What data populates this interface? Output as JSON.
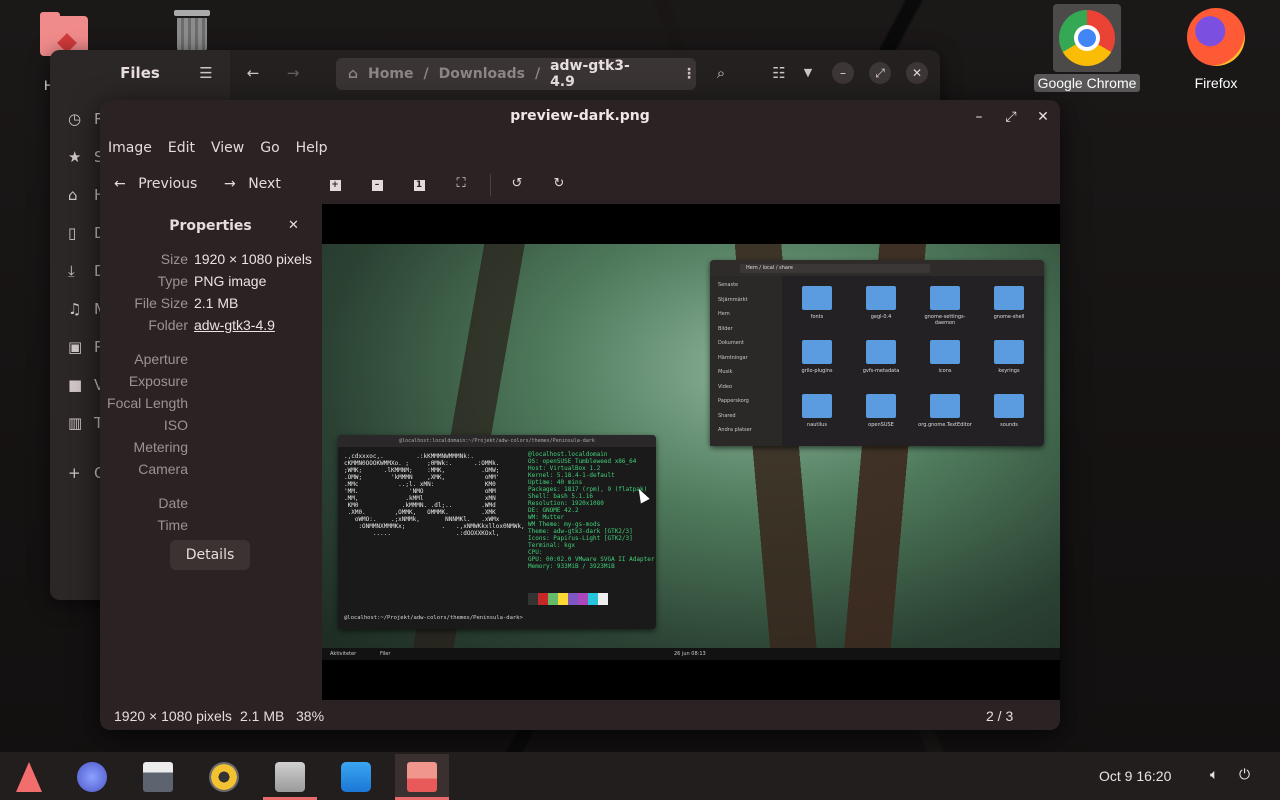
{
  "desktop": {
    "icons": [
      {
        "label": "H",
        "icon": "home-folder-icon"
      },
      {
        "label": "",
        "icon": "trash-icon"
      },
      {
        "label": "Google Chrome",
        "icon": "chrome-icon"
      },
      {
        "label": "Firefox",
        "icon": "firefox-icon"
      }
    ]
  },
  "files_window": {
    "title": "Files",
    "path": [
      "Home",
      "Downloads",
      "adw-gtk3-4.9"
    ],
    "sidebar": [
      "R",
      "S",
      "H",
      "D",
      "D",
      "M",
      "P",
      "V",
      "T",
      "O"
    ]
  },
  "viewer": {
    "title": "preview-dark.png",
    "menu": [
      "Image",
      "Edit",
      "View",
      "Go",
      "Help"
    ],
    "toolbar": {
      "previous": "Previous",
      "next": "Next"
    },
    "properties": {
      "title": "Properties",
      "rows": [
        {
          "key": "Size",
          "value": "1920 × 1080 pixels"
        },
        {
          "key": "Type",
          "value": "PNG image"
        },
        {
          "key": "File Size",
          "value": "2.1 MB"
        },
        {
          "key": "Folder",
          "value": "adw-gtk3-4.9"
        },
        {
          "key": "Aperture",
          "value": ""
        },
        {
          "key": "Exposure",
          "value": ""
        },
        {
          "key": "Focal Length",
          "value": ""
        },
        {
          "key": "ISO",
          "value": ""
        },
        {
          "key": "Metering",
          "value": ""
        },
        {
          "key": "Camera",
          "value": ""
        },
        {
          "key": "Date",
          "value": ""
        },
        {
          "key": "Time",
          "value": ""
        }
      ],
      "details_label": "Details"
    },
    "status": {
      "dimensions": "1920 × 1080 pixels",
      "size": "2.1 MB",
      "zoom": "38%",
      "position": "2 / 3"
    }
  },
  "preview": {
    "files_path": [
      "Hem",
      "local",
      "share"
    ],
    "files_sidebar": [
      "Senaste",
      "Stjärnmärkt",
      "Hem",
      "Bilder",
      "Dokument",
      "Hämtningar",
      "Musik",
      "Video",
      "Papperskorg",
      "Shared",
      "Andra platser"
    ],
    "folders": [
      "fonts",
      "gegl-0.4",
      "gnome-settings-daemon",
      "gnome-shell",
      "grilo-plugins",
      "gvfs-metadata",
      "icons",
      "keyrings",
      "nautilus",
      "openSUSE",
      "org.gnome.TextEditor",
      "sounds"
    ],
    "terminal_title": "@localhost:localdomain:~/Projekt/adw-colors/themes/Peninsula-dark",
    "neofetch_lines": [
      "@localhost.localdomain",
      "OS: openSUSE Tumbleweed x86_64",
      "Host: VirtualBox 1.2",
      "Kernel: 5.18.4-1-default",
      "Uptime: 40 mins",
      "Packages: 1817 (rpm), 9 (flatpak)",
      "Shell: bash 5.1.16",
      "Resolution: 1920x1080",
      "DE: GNOME 42.2",
      "WM: Mutter",
      "WM Theme: my-gs-mods",
      "Theme: adw-gtk3-dark [GTK2/3]",
      "Icons: Papirus-Light [GTK2/3]",
      "Terminal: kgx",
      "CPU:",
      "GPU: 00:02.0 VMware SVGA II Adapter",
      "Memory: 933MiB / 3923MiB"
    ],
    "prompt": "@localhost:~/Projekt/adw-colors/themes/Peninsula-dark> ",
    "panel_left": "Aktiviteter",
    "panel_app": "Filer",
    "panel_clock": "26 jun 08:13"
  },
  "taskbar": {
    "apps": [
      "start-menu-icon",
      "web-browser-icon",
      "calendar-icon",
      "music-player-icon",
      "files-icon",
      "software-store-icon",
      "image-viewer-icon"
    ],
    "clock": "Oct 9  16:20"
  },
  "colors": {
    "accent": "#e86a6a",
    "folder": "#5b9be0",
    "terminal_green": "#3fd07a"
  }
}
